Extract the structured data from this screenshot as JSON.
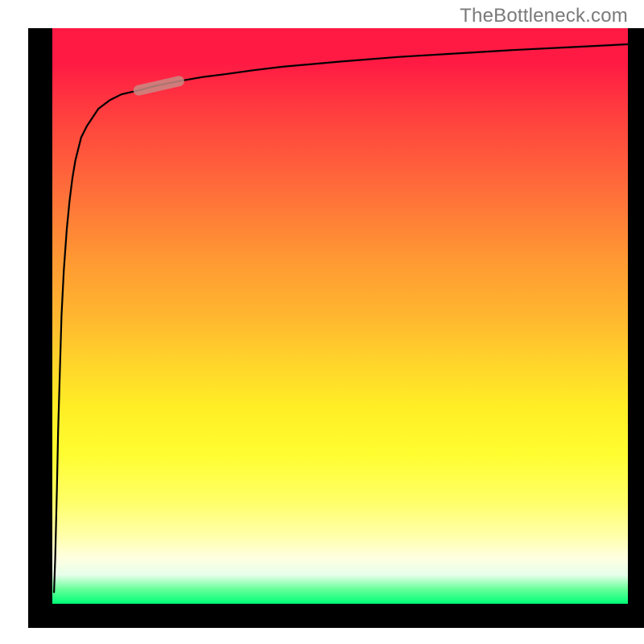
{
  "watermark": {
    "text": "TheBottleneck.com"
  },
  "colors": {
    "frame": "#000000",
    "curve": "#000000",
    "marker": "#c98a84",
    "gradient_top": "#ff1a44",
    "gradient_mid": "#fffd30",
    "gradient_bottom": "#00ff77"
  },
  "chart_data": {
    "type": "line",
    "title": "",
    "xlabel": "",
    "ylabel": "",
    "xlim": [
      0,
      100
    ],
    "ylim": [
      0,
      100
    ],
    "grid": false,
    "annotations": [
      {
        "kind": "segment-highlight",
        "x_range": [
          15,
          22
        ],
        "approx_y": 89
      }
    ],
    "series": [
      {
        "name": "curve",
        "x": [
          0.3,
          0.5,
          0.8,
          1.0,
          1.3,
          1.6,
          2.0,
          2.5,
          3.0,
          3.5,
          4.0,
          5.0,
          6.0,
          8.0,
          10,
          12,
          15,
          18,
          22,
          26,
          30,
          35,
          40,
          50,
          60,
          70,
          80,
          90,
          100
        ],
        "y": [
          2,
          8,
          20,
          30,
          40,
          50,
          58,
          65,
          70,
          74,
          77,
          81,
          83,
          86,
          87.5,
          88.5,
          89.2,
          90,
          90.8,
          91.5,
          92,
          92.7,
          93.3,
          94.2,
          95,
          95.6,
          96.2,
          96.7,
          97.2
        ]
      }
    ]
  }
}
